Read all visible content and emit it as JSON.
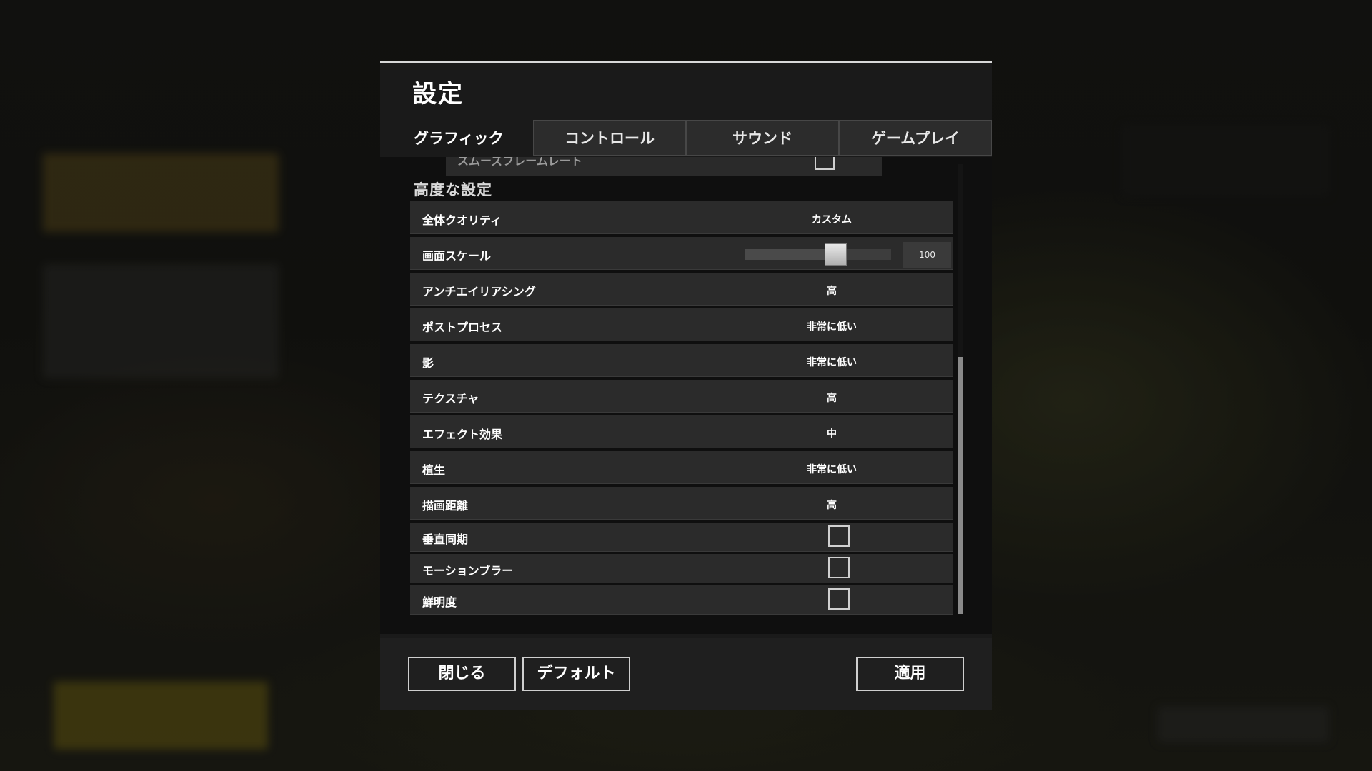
{
  "dialog": {
    "title": "設定"
  },
  "tabs": [
    {
      "label": "グラフィック",
      "active": true
    },
    {
      "label": "コントロール",
      "active": false
    },
    {
      "label": "サウンド",
      "active": false
    },
    {
      "label": "ゲームプレイ",
      "active": false
    }
  ],
  "partial_row": {
    "label": "スムーズフレームレート",
    "checked": false
  },
  "section_title": "高度な設定",
  "settings": [
    {
      "label": "全体クオリティ",
      "type": "dropdown",
      "value": "カスタム"
    },
    {
      "label": "画面スケール",
      "type": "slider",
      "value": "100",
      "fraction": 0.6
    },
    {
      "label": "アンチエイリアシング",
      "type": "dropdown",
      "value": "高"
    },
    {
      "label": "ポストプロセス",
      "type": "dropdown",
      "value": "非常に低い"
    },
    {
      "label": "影",
      "type": "dropdown",
      "value": "非常に低い"
    },
    {
      "label": "テクスチャ",
      "type": "dropdown",
      "value": "高"
    },
    {
      "label": "エフェクト効果",
      "type": "dropdown",
      "value": "中"
    },
    {
      "label": "植生",
      "type": "dropdown",
      "value": "非常に低い"
    },
    {
      "label": "描画距離",
      "type": "dropdown",
      "value": "高"
    },
    {
      "label": "垂直同期",
      "type": "checkbox",
      "checked": false
    },
    {
      "label": "モーションブラー",
      "type": "checkbox",
      "checked": false
    },
    {
      "label": "鮮明度",
      "type": "checkbox",
      "checked": false
    }
  ],
  "footer": {
    "close_label": "閉じる",
    "default_label": "デフォルト",
    "apply_label": "適用"
  },
  "colors": {
    "panel": "#1a1a1a",
    "row": "#2b2b2b",
    "text": "#ffffff",
    "tab_inactive": "#2c2c2c"
  }
}
